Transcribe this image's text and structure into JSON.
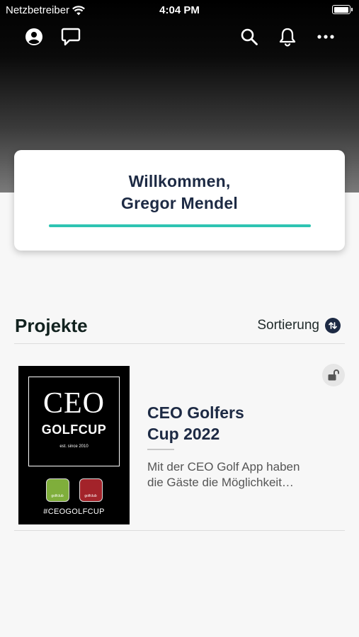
{
  "status_bar": {
    "carrier": "Netzbetreiber",
    "time": "4:04 PM",
    "battery_level": 0.85
  },
  "header": {
    "left_icons": [
      "account-icon",
      "chat-bubble-icon"
    ],
    "right_icons": [
      "search-icon",
      "bell-icon",
      "more-icon"
    ]
  },
  "welcome": {
    "greeting": "Willkommen,",
    "name": "Gregor Mendel",
    "accent_color": "#2ec4b2"
  },
  "projects": {
    "title": "Projekte",
    "sort_label": "Sortierung",
    "items": [
      {
        "title_line1": "CEO Golfers",
        "title_line2": "Cup 2022",
        "description_line1": "Mit der CEO Golf App haben",
        "description_line2": "die Gäste die Möglichkeit…",
        "lock_icon": "unlocked-padlock-icon",
        "cover": {
          "brand": "CEO",
          "subtitle": "GOLFCUP",
          "est": "est. since 2010",
          "hashtag": "#CEOGOLFCUP",
          "logo_left": "golfclub",
          "logo_right": "golfclub"
        }
      }
    ]
  },
  "colors": {
    "navy": "#1d2a44",
    "teal": "#2ec4b2",
    "background": "#f7f7f7"
  }
}
